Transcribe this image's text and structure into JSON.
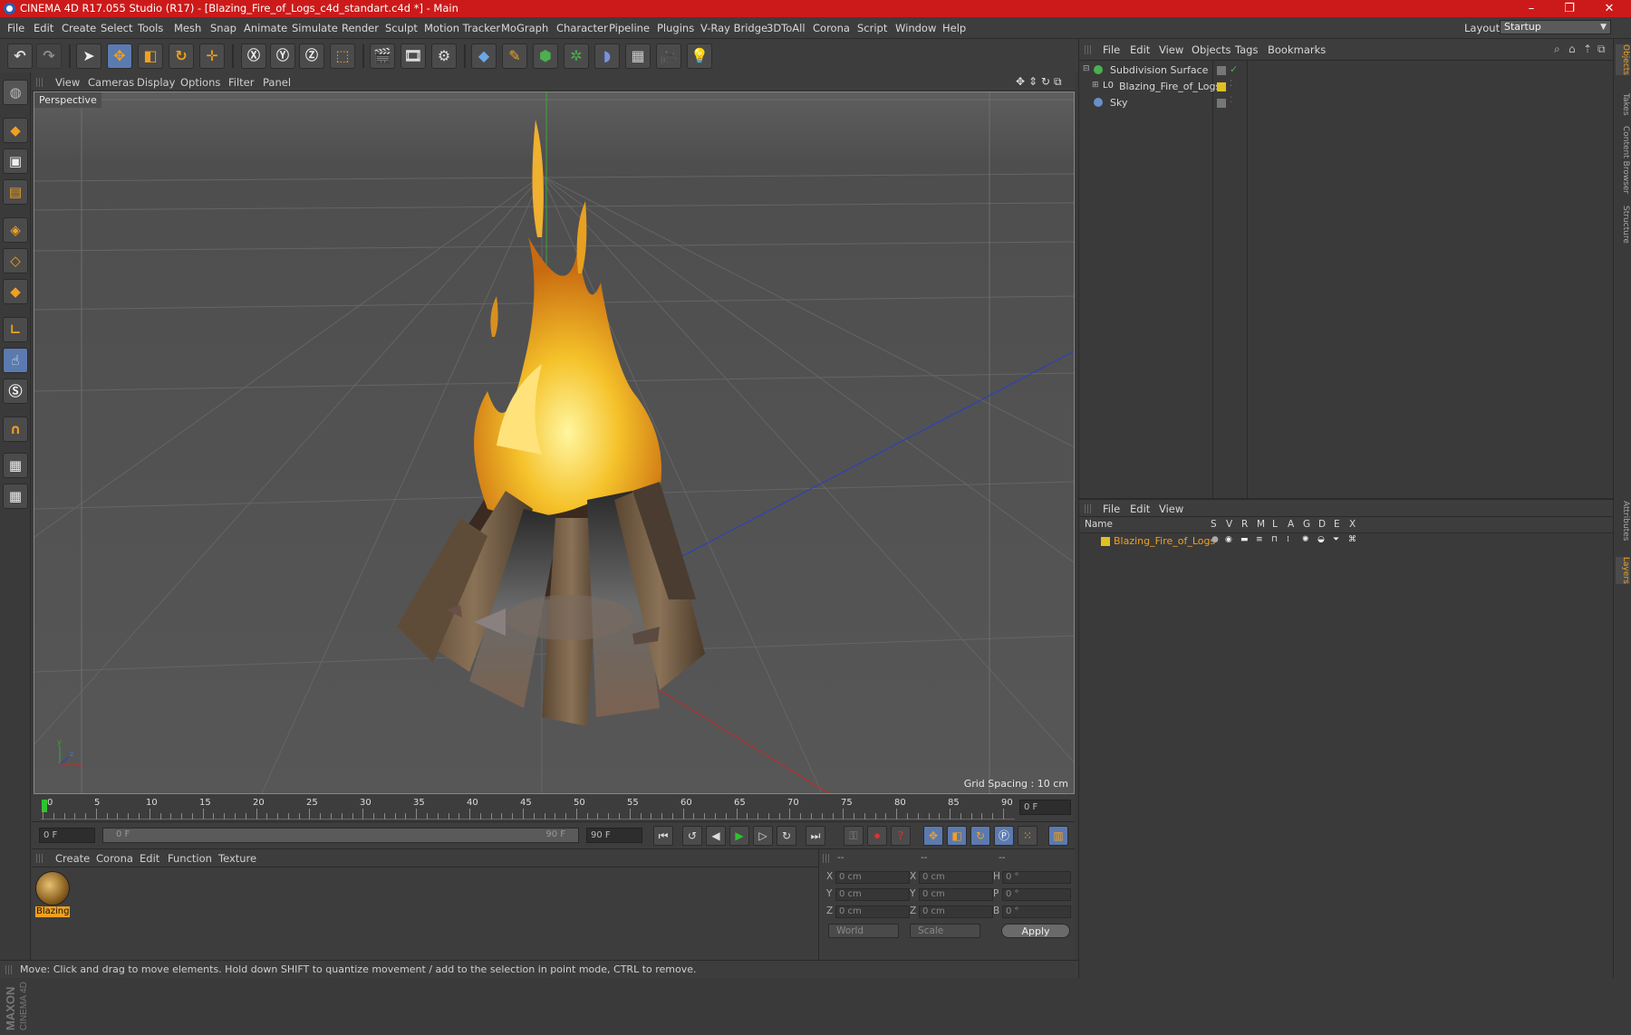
{
  "window": {
    "title": "CINEMA 4D R17.055 Studio (R17) - [Blazing_Fire_of_Logs_c4d_standart.c4d *] - Main",
    "controls": [
      "–",
      "❐",
      "✕"
    ]
  },
  "menubar": {
    "items": [
      "File",
      "Edit",
      "Create",
      "Select",
      "Tools",
      "Mesh",
      "Snap",
      "Animate",
      "Simulate",
      "Render",
      "Sculpt",
      "Motion Tracker",
      "MoGraph",
      "Character",
      "Pipeline",
      "Plugins",
      "V-Ray Bridge",
      "3DToAll",
      "Corona",
      "Script",
      "Window",
      "Help"
    ],
    "layout_label": "Layout:",
    "layout_value": "Startup"
  },
  "viewport": {
    "menu": [
      "View",
      "Cameras",
      "Display",
      "Options",
      "Filter",
      "Panel"
    ],
    "label": "Perspective",
    "grid_spacing": "Grid Spacing : 10 cm"
  },
  "timeline": {
    "ticks": [
      "0",
      "5",
      "10",
      "15",
      "20",
      "25",
      "30",
      "35",
      "40",
      "45",
      "50",
      "55",
      "60",
      "65",
      "70",
      "75",
      "80",
      "85",
      "90"
    ],
    "current_frame": "0 F",
    "start_field": "0 F",
    "slider_start": "0 F",
    "slider_end": "90 F",
    "end_field": "90 F"
  },
  "material_manager": {
    "menu": [
      "Create",
      "Corona",
      "Edit",
      "Function",
      "Texture"
    ],
    "materials": [
      {
        "name": "Blazing"
      }
    ]
  },
  "coordinates": {
    "headers": [
      "--",
      "--",
      "--"
    ],
    "rows": [
      {
        "axis": "X",
        "pos": "0 cm",
        "axis2": "X",
        "size": "0 cm",
        "rot_axis": "H",
        "rot": "0 °"
      },
      {
        "axis": "Y",
        "pos": "0 cm",
        "axis2": "Y",
        "size": "0 cm",
        "rot_axis": "P",
        "rot": "0 °"
      },
      {
        "axis": "Z",
        "pos": "0 cm",
        "axis2": "Z",
        "size": "0 cm",
        "rot_axis": "B",
        "rot": "0 °"
      }
    ],
    "mode_world": "World",
    "mode_scale": "Scale",
    "apply": "Apply"
  },
  "object_manager": {
    "menu": [
      "File",
      "Edit",
      "View",
      "Objects",
      "Tags",
      "Bookmarks"
    ],
    "objects": [
      {
        "name": "Subdivision Surface",
        "color": "#4caf50"
      },
      {
        "name": "Blazing_Fire_of_Logs",
        "color": "#e0c020"
      },
      {
        "name": "Sky",
        "color": "#6a8fc8"
      }
    ]
  },
  "layers_manager": {
    "menu": [
      "File",
      "Edit",
      "View"
    ],
    "columns": [
      "Name",
      "S",
      "V",
      "R",
      "M",
      "L",
      "A",
      "G",
      "D",
      "E",
      "X"
    ],
    "layers": [
      {
        "name": "Blazing_Fire_of_Logs",
        "color": "#e0c020"
      }
    ]
  },
  "right_tabs": [
    "Objects",
    "Takes",
    "Content Browser",
    "Structure",
    "Attributes",
    "Layers"
  ],
  "status": "Move: Click and drag to move elements. Hold down SHIFT to quantize movement / add to the selection in point mode, CTRL to remove.",
  "brand": "MAXON CINEMA 4D",
  "colors": {
    "accent": "#f0a020",
    "title_bar": "#cc1a1a",
    "selected_tool": "#5b7ab0"
  }
}
